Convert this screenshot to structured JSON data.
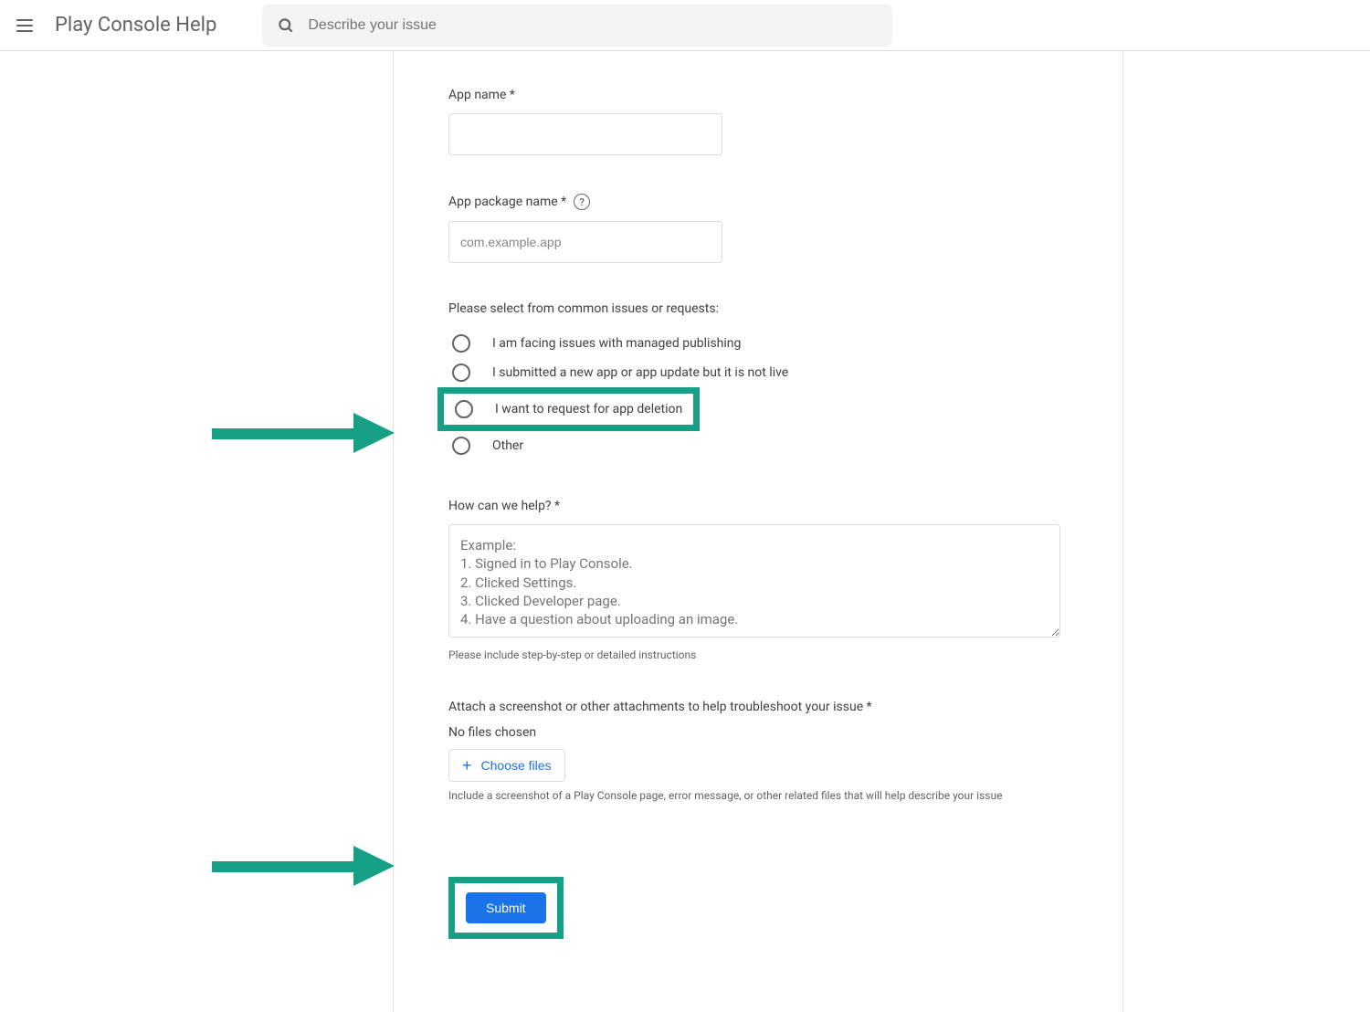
{
  "header": {
    "title": "Play Console Help",
    "search_placeholder": "Describe your issue"
  },
  "form": {
    "app_name": {
      "label": "App name *",
      "value": ""
    },
    "app_package": {
      "label": "App package name *",
      "placeholder": "com.example.app",
      "value": ""
    },
    "issues": {
      "label": "Please select from common issues or requests:",
      "options": [
        "I am facing issues with managed publishing",
        "I submitted a new app or app update but it is not live",
        "I want to request for app deletion",
        "Other"
      ]
    },
    "help": {
      "label": "How can we help? *",
      "placeholder": "Example:\n1. Signed in to Play Console.\n2. Clicked Settings.\n3. Clicked Developer page.\n4. Have a question about uploading an image.",
      "hint": "Please include step-by-step or detailed instructions"
    },
    "attach": {
      "label": "Attach a screenshot or other attachments to help troubleshoot your issue *",
      "status": "No files chosen",
      "button": "Choose files",
      "hint": "Include a screenshot of a Play Console page, error message, or other related files that will help describe your issue"
    },
    "submit": "Submit"
  },
  "colors": {
    "accent": "#1a73e8",
    "highlight": "#16a085"
  }
}
